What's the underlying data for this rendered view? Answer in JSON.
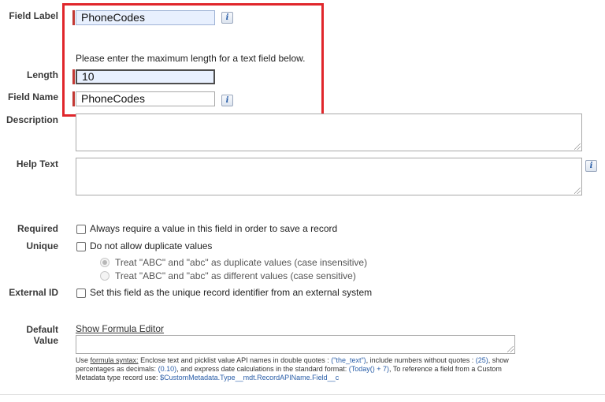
{
  "labels": {
    "field_label": "Field Label",
    "length": "Length",
    "field_name": "Field Name",
    "description": "Description",
    "help_text": "Help Text",
    "required": "Required",
    "unique": "Unique",
    "external_id": "External ID",
    "default_value": "Default Value"
  },
  "fields": {
    "field_label_value": "PhoneCodes",
    "length_value": "10",
    "field_name_value": "PhoneCodes"
  },
  "length_hint": "Please enter the maximum length for a text field below.",
  "checkboxes": {
    "required": "Always require a value in this field in order to save a record",
    "unique": "Do not allow duplicate values",
    "external_id": "Set this field as the unique record identifier from an external system"
  },
  "unique_options": [
    "Treat \"ABC\" and \"abc\" as duplicate values (case insensitive)",
    "Treat \"ABC\" and \"abc\" as different values (case sensitive)"
  ],
  "formula": {
    "link": "Show Formula Editor",
    "hint_use": "Use",
    "hint_syntax": "formula syntax:",
    "hint_1": "Enclose text and picklist value API names in double quotes :",
    "ex_text": "(\"the_text\")",
    "hint_2": ", include numbers without quotes :",
    "ex_num": "(25)",
    "hint_3": ", show percentages as decimals:",
    "ex_pct": "(0.10)",
    "hint_4": ", and express date calculations in the standard format:",
    "ex_date": "(Today() + 7)",
    "hint_5": ", To reference a field from a Custom Metadata type record use:",
    "ex_meta": "$CustomMetadata.Type__mdt.RecordAPIName.Field__c"
  },
  "icons": {
    "info": "i"
  },
  "colors": {
    "highlight_box": "#e0262b",
    "required_bar": "#c23934",
    "link_blue": "#2a5ea8"
  }
}
